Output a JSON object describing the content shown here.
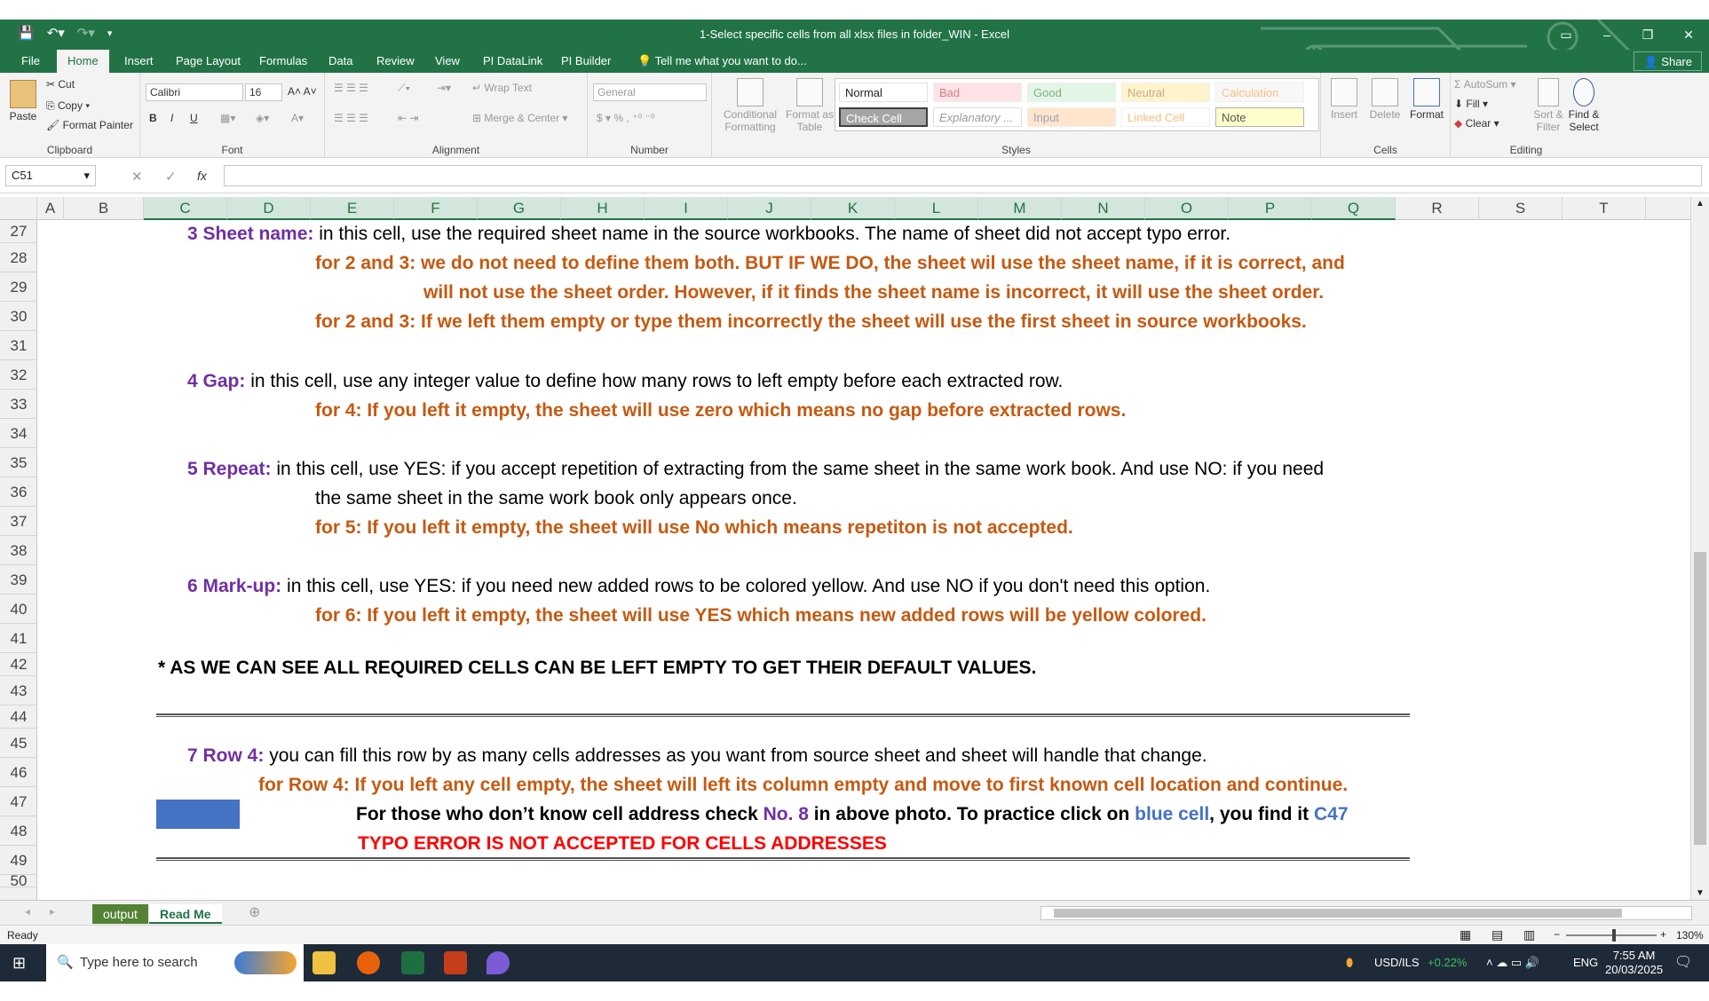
{
  "window": {
    "title": "1-Select specific cells from all xlsx files in folder_WIN - Excel",
    "buttons": [
      "▭",
      "–",
      "❐",
      "✕"
    ]
  },
  "tabs": [
    "File",
    "Home",
    "Insert",
    "Page Layout",
    "Formulas",
    "Data",
    "Review",
    "View",
    "PI DataLink",
    "PI Builder"
  ],
  "tell_me": "Tell me what you want to do...",
  "share": "Share",
  "ribbon": {
    "clipboard": {
      "paste": "Paste",
      "cut": "Cut",
      "copy": "Copy",
      "format_painter": "Format Painter",
      "label": "Clipboard"
    },
    "font": {
      "name": "Calibri",
      "size": "16",
      "label": "Font",
      "bold": "B",
      "italic": "I",
      "underline": "U"
    },
    "alignment": {
      "wrap": "Wrap Text",
      "merge": "Merge & Center",
      "label": "Alignment"
    },
    "number": {
      "format": "General",
      "label": "Number"
    },
    "styles": {
      "conditional": "Conditional Formatting",
      "format_table": "Format as Table",
      "cells": [
        "Normal",
        "Bad",
        "Good",
        "Neutral",
        "Calculation",
        "Check Cell",
        "Explanatory ...",
        "Input",
        "Linked Cell",
        "Note"
      ],
      "label": "Styles"
    },
    "cells": {
      "insert": "Insert",
      "delete": "Delete",
      "format": "Format",
      "label": "Cells"
    },
    "editing": {
      "autosum": "AutoSum",
      "fill": "Fill",
      "clear": "Clear",
      "sort": "Sort & Filter",
      "find": "Find & Select",
      "label": "Editing"
    }
  },
  "formula_bar": {
    "name_box": "C51",
    "fx": "fx",
    "value": ""
  },
  "columns": [
    "A",
    "B",
    "C",
    "D",
    "E",
    "F",
    "G",
    "H",
    "I",
    "J",
    "K",
    "L",
    "M",
    "N",
    "O",
    "P",
    "Q",
    "R",
    "S",
    "T"
  ],
  "rows": [
    "27",
    "28",
    "29",
    "30",
    "31",
    "32",
    "33",
    "34",
    "35",
    "36",
    "37",
    "38",
    "39",
    "40",
    "41",
    "42",
    "43",
    "44",
    "45",
    "46",
    "47",
    "48",
    "49",
    "50"
  ],
  "content": {
    "r28_label": "3 Sheet name:",
    "r28_text": " in this cell, use the required sheet name in the source workbooks. The name of sheet did not accept typo error.",
    "r29": "for 2 and 3: we do not need to define them both. BUT IF WE DO, the sheet wil use the sheet name, if it is correct, and",
    "r30": "will not use the sheet order. However, if it finds the sheet name is incorrect, it will use the sheet order.",
    "r31": "for 2 and 3: If we left them empty or type them incorrectly the sheet will use the first sheet in source workbooks.",
    "r33_label": "4 Gap:",
    "r33_text": " in this cell, use any integer value to define how many rows to left empty before each extracted row.",
    "r34": "for 4: If you left it empty, the sheet will use zero which means no gap before extracted rows.",
    "r36_label": "5 Repeat:",
    "r36_text": " in this cell, use YES: if you accept repetition of extracting from the same sheet in the same work book. And use NO: if you need",
    "r37": "the same sheet in the same work book only appears once.",
    "r38": "for 5: If you left it empty, the sheet will use No which means repetiton is not accepted.",
    "r40_label": "6 Mark-up:",
    "r40_text": " in this cell, use YES: if you need new added rows to be colored yellow. And use NO if you don't need this option.",
    "r41": "for 6: If you left it empty, the sheet will use YES which means new added rows will be yellow colored.",
    "r43": "* AS WE CAN SEE ALL REQUIRED CELLS CAN BE LEFT EMPTY TO GET THEIR DEFAULT VALUES.",
    "r45_label": "7 Row 4:",
    "r45_text": "  you can fill this row by as many cells addresses as you want from source sheet and sheet will handle that change.",
    "r46": "for Row 4: If you left any cell empty, the sheet will left its column empty and move to first known cell location and continue.",
    "r47_a": "For those who don’t know cell address check ",
    "r47_b": "No. 8",
    "r47_c": " in above photo. To practice click on ",
    "r47_d": "blue cell",
    "r47_e": ", you find it ",
    "r47_f": "C47",
    "r48": "TYPO ERROR IS NOT ACCEPTED FOR CELLS ADDRESSES"
  },
  "sheets": [
    "output",
    "Read Me"
  ],
  "status": {
    "ready": "Ready",
    "zoom": "130%"
  },
  "taskbar": {
    "search_placeholder": "Type here to search",
    "ticker": "USD/ILS",
    "ticker_change": "+0.22%",
    "lang": "ENG",
    "time": "7:55 AM",
    "date": "20/03/2025"
  },
  "colors": {
    "excel_green": "#217346",
    "purple": "#7030a0",
    "orange": "#c55a11",
    "blue_cell": "#4472c4",
    "red": "#ff0000"
  }
}
